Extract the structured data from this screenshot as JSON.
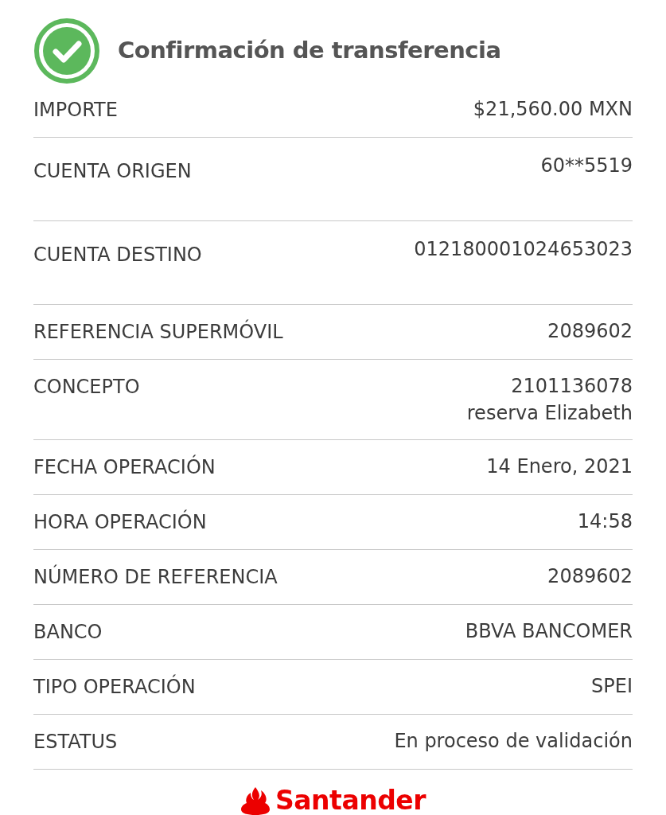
{
  "header": {
    "title": "Confirmación de transferencia"
  },
  "rows": [
    {
      "kind": "plain",
      "label": "IMPORTE",
      "value": [
        "$21,560.00 MXN"
      ]
    },
    {
      "kind": "account",
      "label": "CUENTA ORIGEN",
      "value": [
        "60**5519"
      ]
    },
    {
      "kind": "account",
      "label": "CUENTA DESTINO",
      "value": [
        "012180001024653023"
      ]
    },
    {
      "kind": "plain",
      "label": "REFERENCIA SUPERMÓVIL",
      "value": [
        "2089602"
      ]
    },
    {
      "kind": "plain",
      "label": "CONCEPTO",
      "value": [
        "2101136078",
        "reserva Elizabeth"
      ]
    },
    {
      "kind": "plain",
      "label": "FECHA OPERACIÓN",
      "value": [
        "14 Enero, 2021"
      ]
    },
    {
      "kind": "plain",
      "label": "HORA OPERACIÓN",
      "value": [
        "14:58"
      ]
    },
    {
      "kind": "plain",
      "label": "NÚMERO DE REFERENCIA",
      "value": [
        "2089602"
      ]
    },
    {
      "kind": "plain",
      "label": "BANCO",
      "value": [
        "BBVA BANCOMER"
      ]
    },
    {
      "kind": "plain",
      "label": "TIPO OPERACIÓN",
      "value": [
        "SPEI"
      ]
    },
    {
      "kind": "plain",
      "label": "ESTATUS",
      "value": [
        "En proceso de validación"
      ]
    }
  ],
  "footer": {
    "brand": "Santander"
  }
}
